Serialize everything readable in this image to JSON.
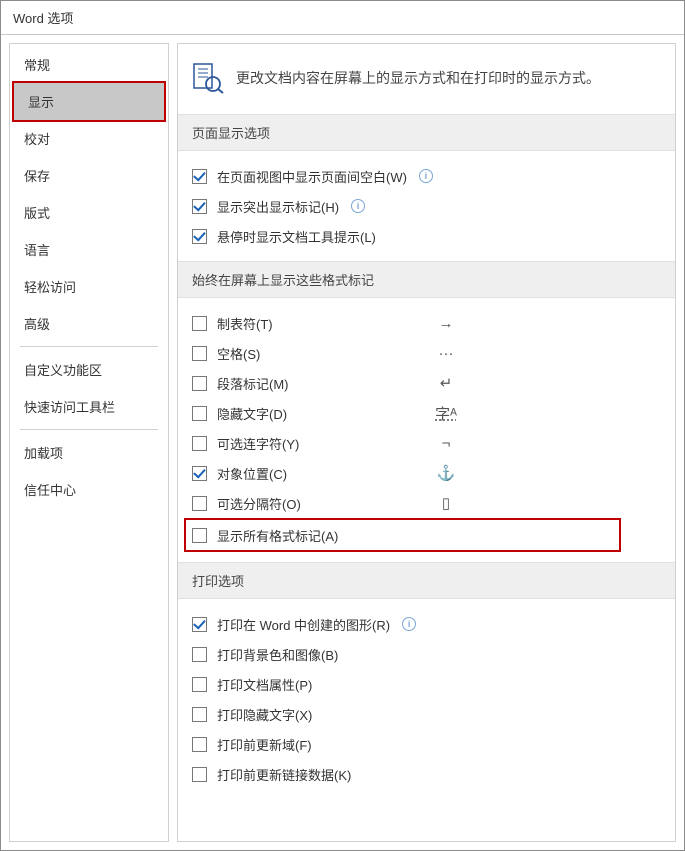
{
  "title": "Word 选项",
  "sidebar": {
    "items": [
      "常规",
      "显示",
      "校对",
      "保存",
      "版式",
      "语言",
      "轻松访问",
      "高级",
      "自定义功能区",
      "快速访问工具栏",
      "加载项",
      "信任中心"
    ],
    "selected": 1
  },
  "hero": "更改文档内容在屏幕上的显示方式和在打印时的显示方式。",
  "sec1": {
    "head": "页面显示选项",
    "r0": "在页面视图中显示页面间空白(W)",
    "r1": "显示突出显示标记(H)",
    "r2": "悬停时显示文档工具提示(L)"
  },
  "sec2": {
    "head": "始终在屏幕上显示这些格式标记",
    "r0": {
      "l": "制表符(T)",
      "s": "→"
    },
    "r1": {
      "l": "空格(S)",
      "s": "···"
    },
    "r2": {
      "l": "段落标记(M)",
      "s": "↵"
    },
    "r3": {
      "l": "隐藏文字(D)",
      "s": "字ᴬ"
    },
    "r4": {
      "l": "可选连字符(Y)",
      "s": "¬"
    },
    "r5": {
      "l": "对象位置(C)",
      "s": "⚓"
    },
    "r6": {
      "l": "可选分隔符(O)",
      "s": "▯"
    },
    "r7": {
      "l": "显示所有格式标记(A)"
    }
  },
  "sec3": {
    "head": "打印选项",
    "r0": "打印在 Word 中创建的图形(R)",
    "r1": "打印背景色和图像(B)",
    "r2": "打印文档属性(P)",
    "r3": "打印隐藏文字(X)",
    "r4": "打印前更新域(F)",
    "r5": "打印前更新链接数据(K)"
  }
}
